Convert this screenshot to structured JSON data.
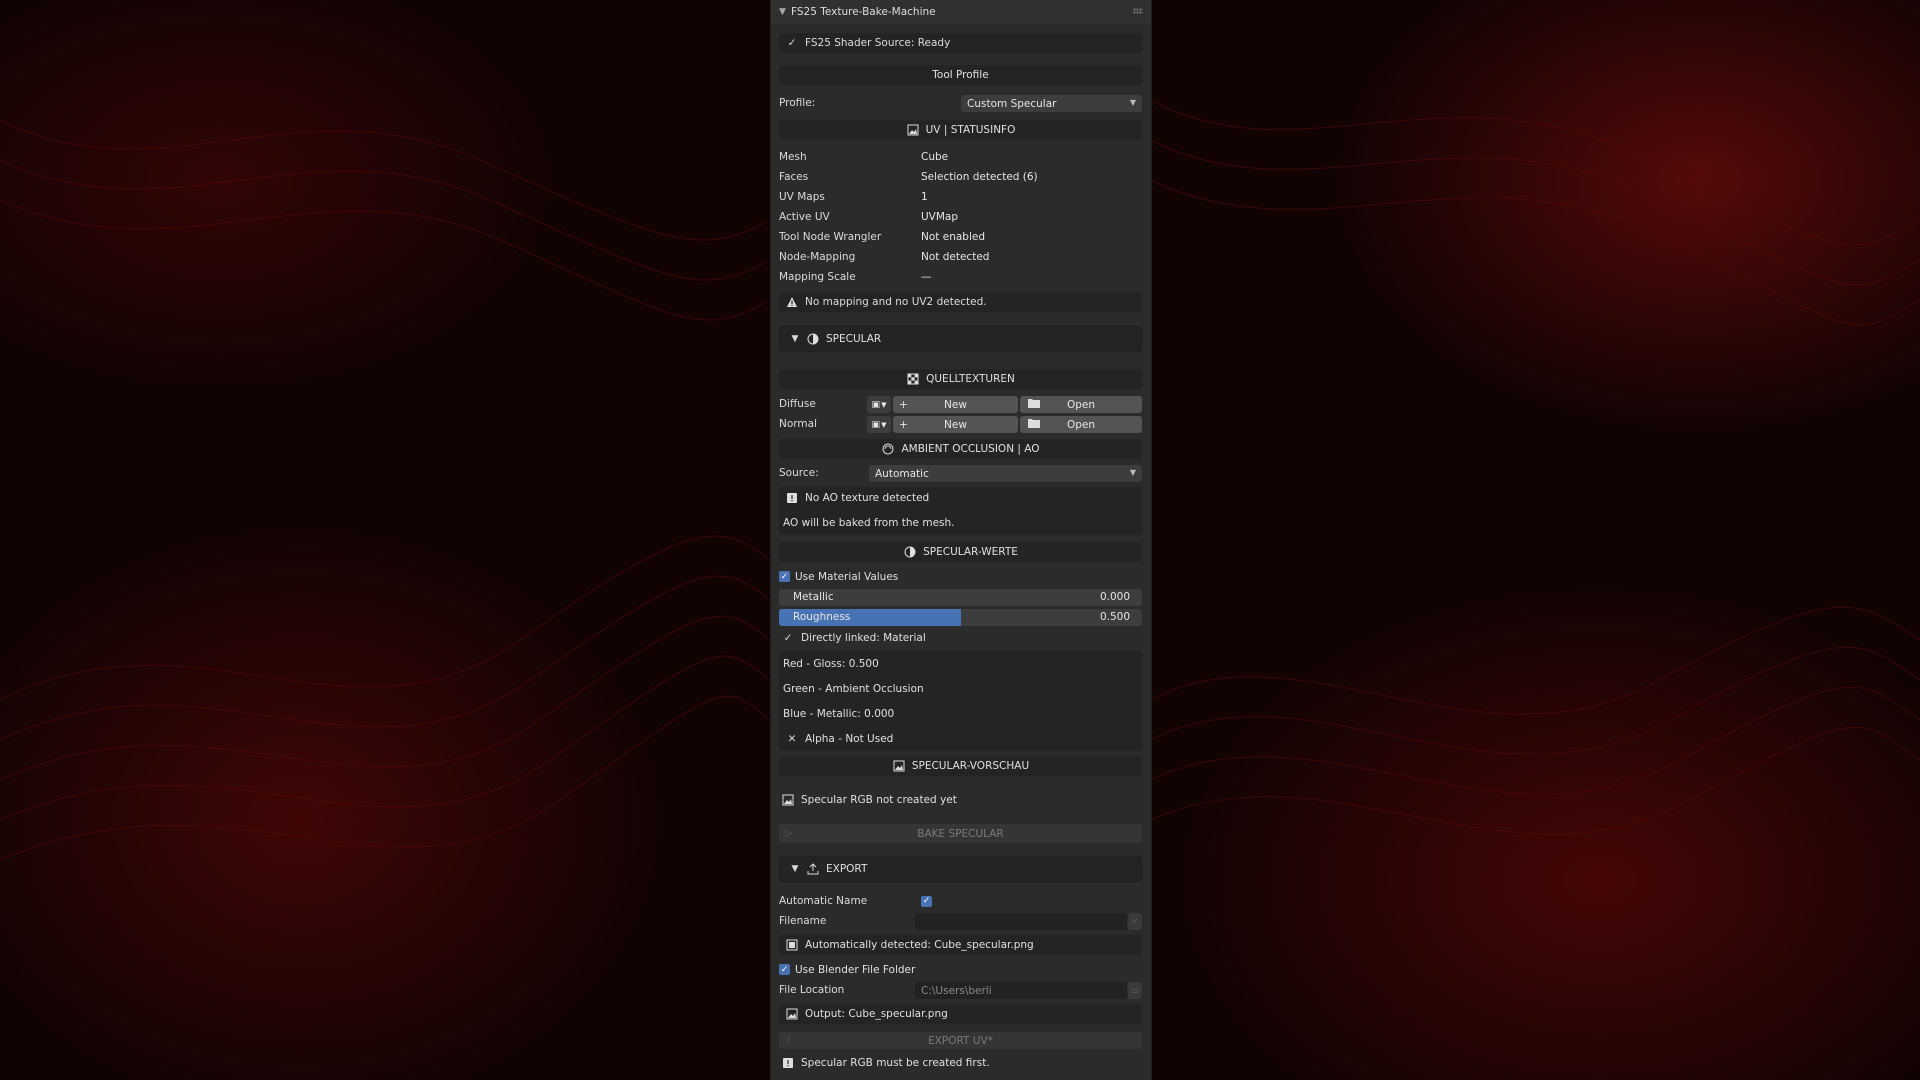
{
  "panel": {
    "title": "FS25 Texture-Bake-Machine"
  },
  "shader_status": "FS25 Shader Source: Ready",
  "tool_profile": {
    "header": "Tool Profile",
    "profile_label": "Profile:",
    "profile_value": "Custom Specular"
  },
  "uv_status": {
    "header": "UV | STATUSINFO",
    "rows": [
      {
        "key": "Mesh",
        "value": "Cube"
      },
      {
        "key": "Faces",
        "value": "Selection detected (6)"
      },
      {
        "key": "UV Maps",
        "value": "1"
      },
      {
        "key": "Active UV",
        "value": "UVMap"
      },
      {
        "key": "Tool Node Wrangler",
        "value": "Not enabled"
      },
      {
        "key": "Node-Mapping",
        "value": "Not detected"
      },
      {
        "key": "Mapping Scale",
        "value": "—"
      }
    ],
    "warning": "No mapping and no UV2 detected."
  },
  "specular_section": {
    "header": "SPECULAR"
  },
  "source_textures": {
    "header": "QUELLTEXTUREN",
    "rows": [
      {
        "label": "Diffuse",
        "new": "New",
        "open": "Open"
      },
      {
        "label": "Normal",
        "new": "New",
        "open": "Open"
      }
    ]
  },
  "ao": {
    "header": "AMBIENT OCCLUSION | AO",
    "source_label": "Source:",
    "source_value": "Automatic",
    "info": "No AO texture detected",
    "note": "AO will be baked from the mesh."
  },
  "specular_values": {
    "header": "SPECULAR-WERTE",
    "use_material_values": "Use Material Values",
    "metallic_label": "Metallic",
    "metallic_value": "0.000",
    "metallic_fraction": 0.0,
    "roughness_label": "Roughness",
    "roughness_value": "0.500",
    "roughness_fraction": 0.5,
    "linked": "Directly linked: Material",
    "channels": [
      "Red - Gloss: 0.500",
      "Green - Ambient Occlusion",
      "Blue - Metallic: 0.000",
      "Alpha - Not Used"
    ]
  },
  "specular_preview": {
    "header": "SPECULAR-VORSCHAU",
    "status": "Specular RGB not created yet",
    "bake_button": "BAKE SPECULAR"
  },
  "export": {
    "header": "EXPORT",
    "auto_name_label": "Automatic Name",
    "filename_label": "Filename",
    "auto_detected": "Automatically detected: Cube_specular.png",
    "use_blend_folder": "Use Blender File Folder",
    "file_location_label": "File Location",
    "file_location_value": "C:\\Users\\berli",
    "output": "Output: Cube_specular.png",
    "export_button": "EXPORT UV*",
    "note": "Specular RGB must be created first."
  },
  "colors": {
    "panel_bg": "#2b2b2b",
    "accent": "#4772b3",
    "background_red": "#8c0f0f"
  }
}
